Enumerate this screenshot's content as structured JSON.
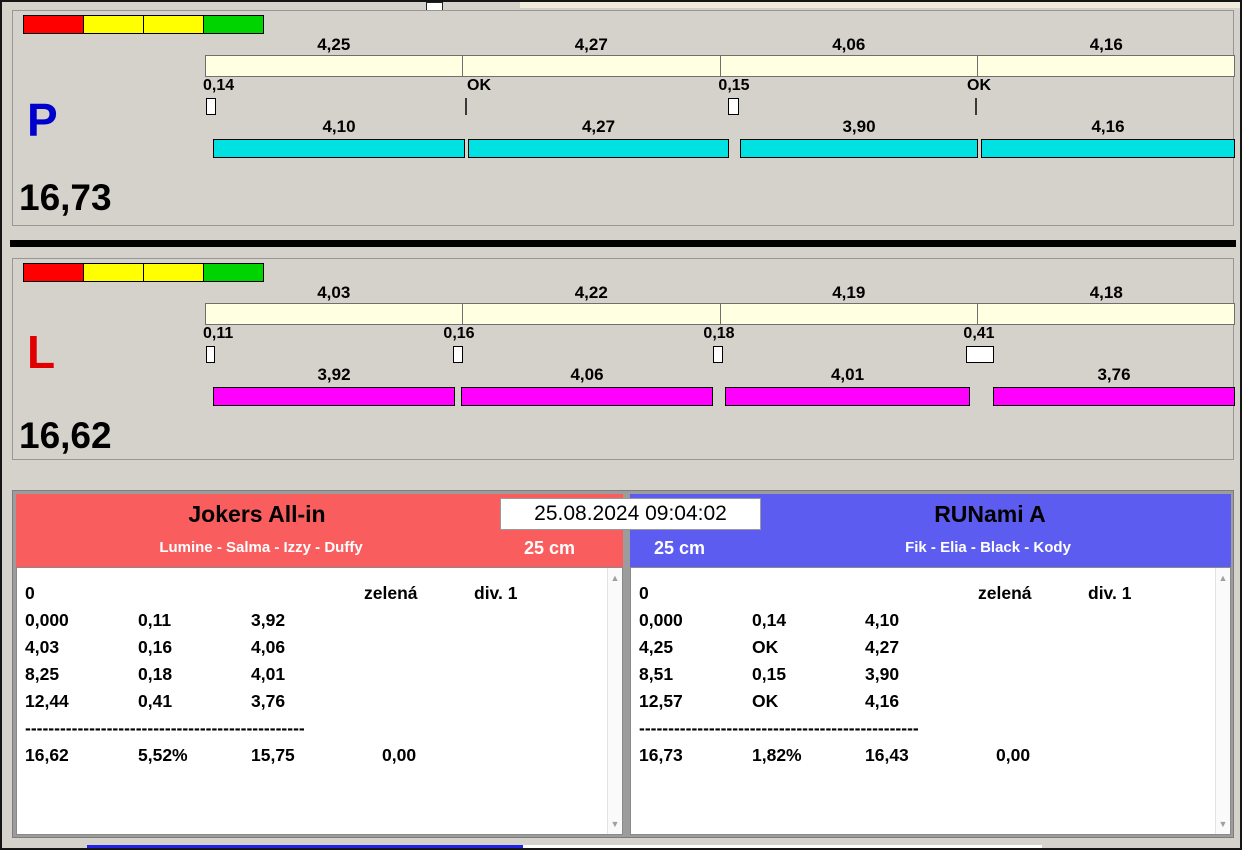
{
  "timestamp": "25.08.2024 09:04:02",
  "split_bar_color": "#ffffe1",
  "traffic_light_colors": [
    "#ff0000",
    "#ffff00",
    "#ffff00",
    "#00d400"
  ],
  "scrollbar": {
    "up": "▲",
    "down": "▼"
  },
  "lanes": [
    {
      "letter": "P",
      "letter_color": "#0000cc",
      "bar_color": "#00e2e2",
      "total": "16,73",
      "splits": [
        "4,25",
        "4,27",
        "4,06",
        "4,16"
      ],
      "marks": [
        "0,14",
        "OK",
        "0,15",
        "OK"
      ],
      "dog_times": [
        "4,10",
        "4,27",
        "3,90",
        "4,16"
      ]
    },
    {
      "letter": "L",
      "letter_color": "#e00000",
      "bar_color": "#ff00ff",
      "total": "16,62",
      "splits": [
        "4,03",
        "4,22",
        "4,19",
        "4,18"
      ],
      "marks": [
        "0,11",
        "0,16",
        "0,18",
        "0,41"
      ],
      "dog_times": [
        "3,92",
        "4,06",
        "4,01",
        "3,76"
      ]
    }
  ],
  "teams": [
    {
      "name": "Jokers All-in",
      "dogs": "Lumine - Salma - Izzy - Duffy",
      "height_class": "25 cm",
      "header_color": "#fa5d5d",
      "status": [
        "0",
        "zelená",
        "div. 1"
      ],
      "rows": [
        [
          "0,000",
          "0,11",
          "3,92"
        ],
        [
          "4,03",
          "0,16",
          "4,06"
        ],
        [
          "8,25",
          "0,18",
          "4,01"
        ],
        [
          "12,44",
          "0,41",
          "3,76"
        ]
      ],
      "separator": "------------------------------------------------",
      "summary": [
        "16,62",
        "5,52%",
        "15,75",
        "0,00"
      ]
    },
    {
      "name": "RUNami A",
      "dogs": "Fik - Elia - Black - Kody",
      "height_class": "25 cm",
      "header_color": "#5c5cf0",
      "status": [
        "0",
        "zelená",
        "div. 1"
      ],
      "rows": [
        [
          "0,000",
          "0,14",
          "4,10"
        ],
        [
          "4,25",
          "OK",
          "4,27"
        ],
        [
          "8,51",
          "0,15",
          "3,90"
        ],
        [
          "12,57",
          "OK",
          "4,16"
        ]
      ],
      "separator": "------------------------------------------------",
      "summary": [
        "16,73",
        "1,82%",
        "16,43",
        "0,00"
      ]
    }
  ]
}
